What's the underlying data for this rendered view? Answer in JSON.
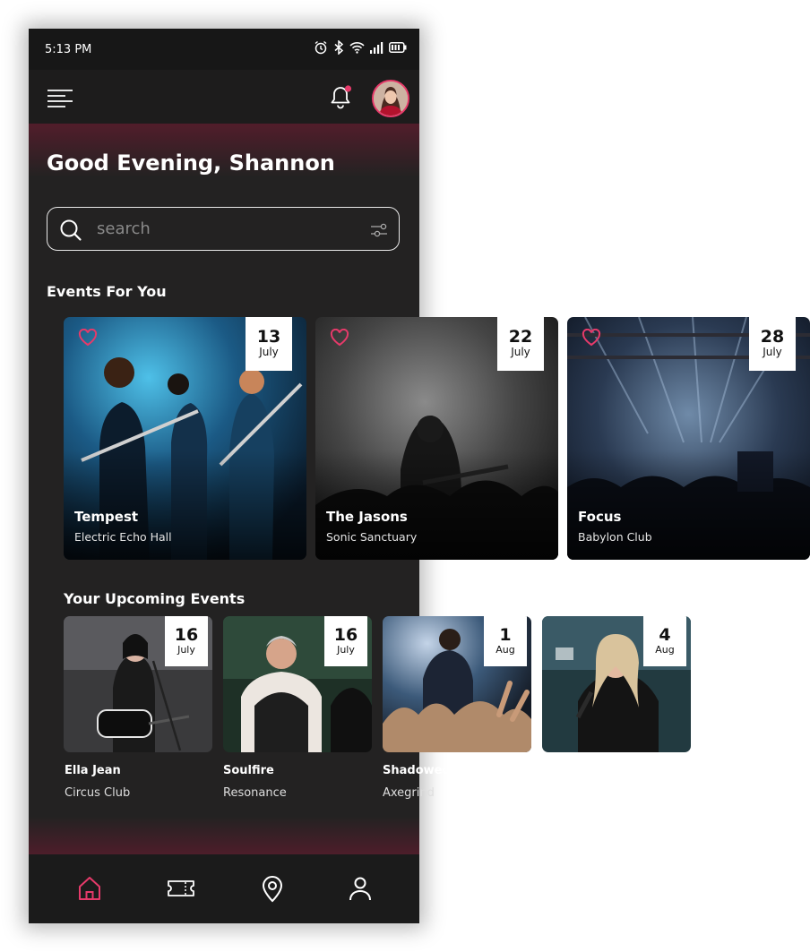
{
  "status_bar": {
    "time": "5:13 PM",
    "icons": [
      "alarm-icon",
      "bluetooth-icon",
      "wifi-icon",
      "signal-icon",
      "battery-icon"
    ]
  },
  "app_bar": {
    "icons": [
      "menu-icon",
      "bell-icon"
    ],
    "has_notification": true
  },
  "greeting": "Good Evening, Shannon",
  "search": {
    "placeholder": "search"
  },
  "sections": {
    "events_for_you": "Events For You",
    "upcoming": "Your Upcoming Events"
  },
  "events_for_you": [
    {
      "day": "13",
      "month": "July",
      "title": "Tempest",
      "venue": "Electric Echo Hall"
    },
    {
      "day": "22",
      "month": "July",
      "title": "The Jasons",
      "venue": "Sonic Sanctuary"
    },
    {
      "day": "28",
      "month": "July",
      "title": "Focus",
      "venue": "Babylon Club"
    }
  ],
  "upcoming_events": [
    {
      "day": "16",
      "month": "July",
      "title": "Ella Jean",
      "venue": "Circus Club"
    },
    {
      "day": "16",
      "month": "July",
      "title": "Soulfire",
      "venue": "Resonance"
    },
    {
      "day": "1",
      "month": "Aug",
      "title": "Shadowed",
      "venue": "Axegrind"
    },
    {
      "day": "4",
      "month": "Aug",
      "title": "",
      "venue": ""
    }
  ],
  "bottom_nav": [
    "home-icon",
    "ticket-icon",
    "map-pin-icon",
    "profile-icon"
  ],
  "colors": {
    "accent": "#e63a6a",
    "background": "#232222",
    "bar": "#1b1b1b"
  }
}
